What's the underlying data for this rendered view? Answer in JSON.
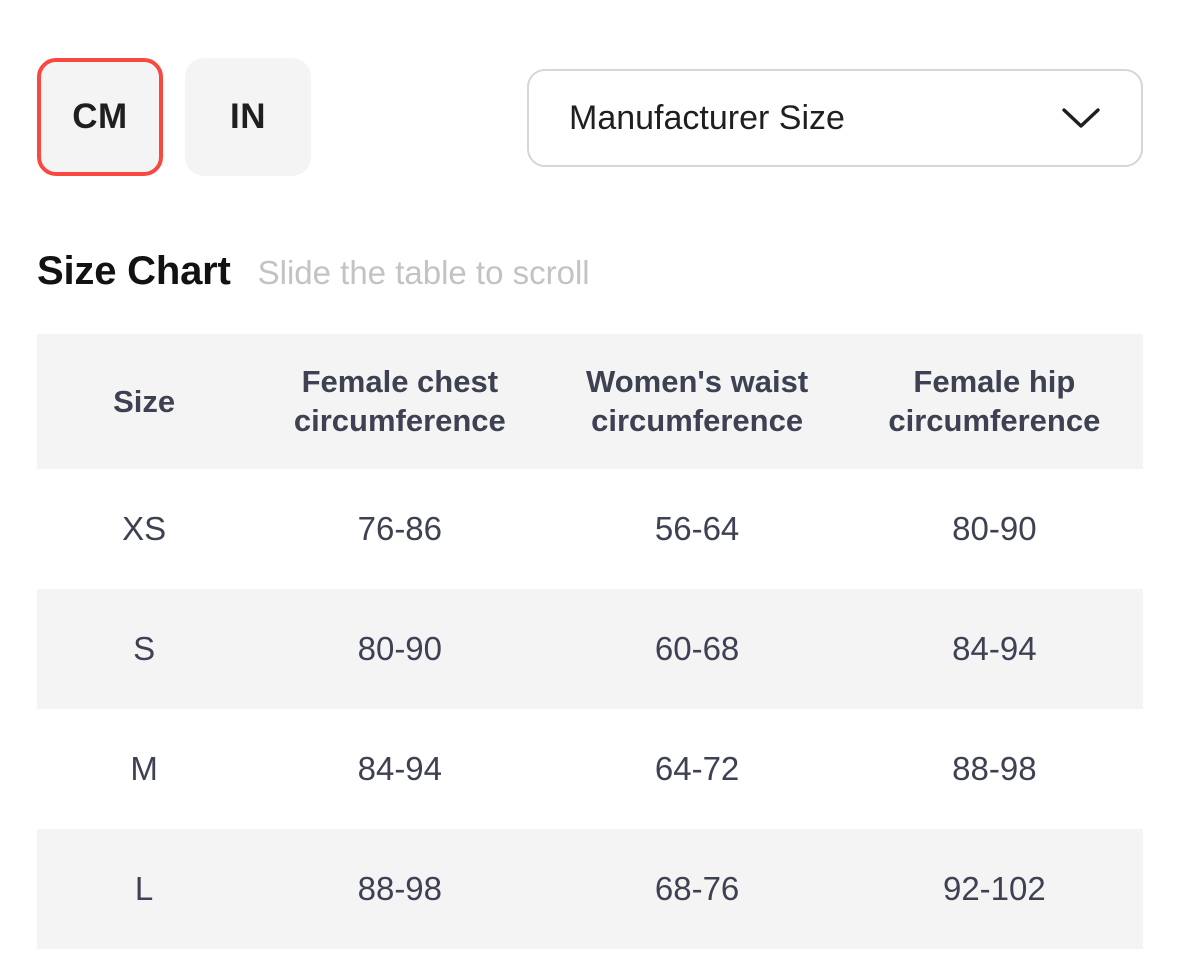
{
  "units": {
    "options": [
      {
        "label": "CM",
        "selected": true
      },
      {
        "label": "IN",
        "selected": false
      }
    ],
    "selected_accent": "#f94840"
  },
  "size_select": {
    "value": "Manufacturer Size",
    "icon": "chevron-down-icon"
  },
  "section": {
    "title": "Size Chart",
    "hint": "Slide the table to scroll"
  },
  "table": {
    "headers": [
      "Size",
      "Female chest circumference",
      "Women's waist circumference",
      "Female hip circumference"
    ],
    "header_lines": [
      [
        "Size"
      ],
      [
        "Female chest",
        "circumference"
      ],
      [
        "Women's waist",
        "circumference"
      ],
      [
        "Female hip",
        "circumference"
      ]
    ],
    "rows": [
      {
        "size": "XS",
        "chest": "76-86",
        "waist": "56-64",
        "hip": "80-90"
      },
      {
        "size": "S",
        "chest": "80-90",
        "waist": "60-68",
        "hip": "84-94"
      },
      {
        "size": "M",
        "chest": "84-94",
        "waist": "64-72",
        "hip": "88-98"
      },
      {
        "size": "L",
        "chest": "88-98",
        "waist": "68-76",
        "hip": "92-102"
      }
    ]
  },
  "colors": {
    "accent_red": "#f94840",
    "surface_gray": "#f4f4f5",
    "text_slate": "#3d4152",
    "text_hint": "#c3c3c6",
    "border_gray": "#d6d6d8"
  }
}
